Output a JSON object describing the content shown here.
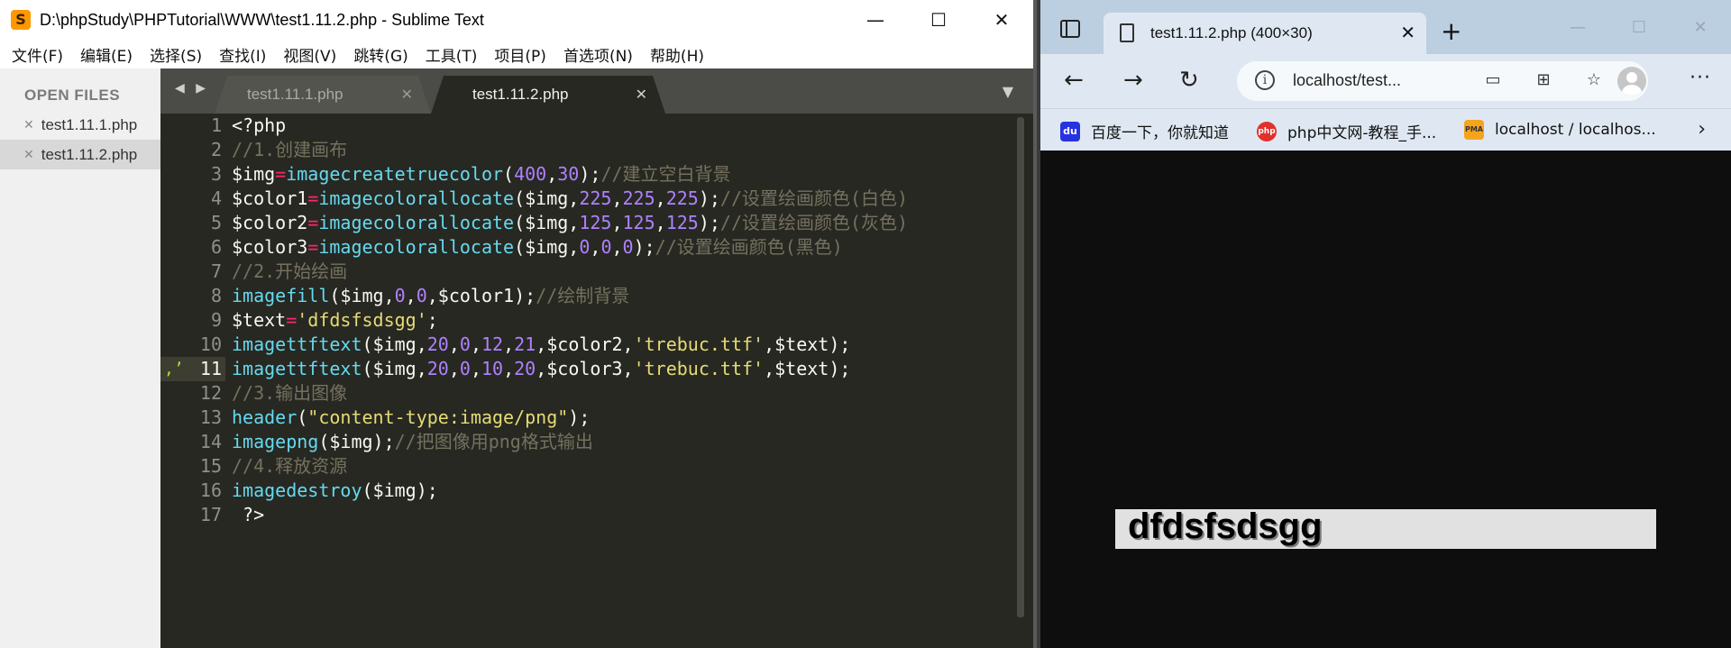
{
  "sublime": {
    "title": "D:\\phpStudy\\PHPTutorial\\WWW\\test1.11.2.php - Sublime Text",
    "logo": "S",
    "menu": [
      "文件(F)",
      "编辑(E)",
      "选择(S)",
      "查找(I)",
      "视图(V)",
      "跳转(G)",
      "工具(T)",
      "项目(P)",
      "首选项(N)",
      "帮助(H)"
    ],
    "sidebar": {
      "heading": "OPEN FILES",
      "files": [
        {
          "name": "test1.11.1.php",
          "active": false
        },
        {
          "name": "test1.11.2.php",
          "active": true
        }
      ]
    },
    "tabs": [
      {
        "label": "test1.11.1.php",
        "active": false
      },
      {
        "label": "test1.11.2.php",
        "active": true
      }
    ],
    "current_line": 11,
    "code_lines": [
      [
        {
          "t": "<?php",
          "c": "pl"
        }
      ],
      [
        {
          "t": "//1.创建画布",
          "c": "cmt"
        }
      ],
      [
        {
          "t": "$img",
          "c": "pl"
        },
        {
          "t": "=",
          "c": "op"
        },
        {
          "t": "imagecreatetruecolor",
          "c": "fn"
        },
        {
          "t": "(",
          "c": "pl"
        },
        {
          "t": "400",
          "c": "num"
        },
        {
          "t": ",",
          "c": "pl"
        },
        {
          "t": "30",
          "c": "num"
        },
        {
          "t": ");",
          "c": "pl"
        },
        {
          "t": "//建立空白背景",
          "c": "cmt"
        }
      ],
      [
        {
          "t": "$color1",
          "c": "pl"
        },
        {
          "t": "=",
          "c": "op"
        },
        {
          "t": "imagecolorallocate",
          "c": "fn"
        },
        {
          "t": "($img,",
          "c": "pl"
        },
        {
          "t": "225",
          "c": "num"
        },
        {
          "t": ",",
          "c": "pl"
        },
        {
          "t": "225",
          "c": "num"
        },
        {
          "t": ",",
          "c": "pl"
        },
        {
          "t": "225",
          "c": "num"
        },
        {
          "t": ");",
          "c": "pl"
        },
        {
          "t": "//设置绘画颜色(白色)",
          "c": "cmt"
        }
      ],
      [
        {
          "t": "$color2",
          "c": "pl"
        },
        {
          "t": "=",
          "c": "op"
        },
        {
          "t": "imagecolorallocate",
          "c": "fn"
        },
        {
          "t": "($img,",
          "c": "pl"
        },
        {
          "t": "125",
          "c": "num"
        },
        {
          "t": ",",
          "c": "pl"
        },
        {
          "t": "125",
          "c": "num"
        },
        {
          "t": ",",
          "c": "pl"
        },
        {
          "t": "125",
          "c": "num"
        },
        {
          "t": ");",
          "c": "pl"
        },
        {
          "t": "//设置绘画颜色(灰色)",
          "c": "cmt"
        }
      ],
      [
        {
          "t": "$color3",
          "c": "pl"
        },
        {
          "t": "=",
          "c": "op"
        },
        {
          "t": "imagecolorallocate",
          "c": "fn"
        },
        {
          "t": "($img,",
          "c": "pl"
        },
        {
          "t": "0",
          "c": "num"
        },
        {
          "t": ",",
          "c": "pl"
        },
        {
          "t": "0",
          "c": "num"
        },
        {
          "t": ",",
          "c": "pl"
        },
        {
          "t": "0",
          "c": "num"
        },
        {
          "t": ");",
          "c": "pl"
        },
        {
          "t": "//设置绘画颜色(黑色)",
          "c": "cmt"
        }
      ],
      [
        {
          "t": "//2.开始绘画",
          "c": "cmt"
        }
      ],
      [
        {
          "t": "imagefill",
          "c": "fn"
        },
        {
          "t": "($img,",
          "c": "pl"
        },
        {
          "t": "0",
          "c": "num"
        },
        {
          "t": ",",
          "c": "pl"
        },
        {
          "t": "0",
          "c": "num"
        },
        {
          "t": ",$color1);",
          "c": "pl"
        },
        {
          "t": "//绘制背景",
          "c": "cmt"
        }
      ],
      [
        {
          "t": "$text",
          "c": "pl"
        },
        {
          "t": "=",
          "c": "op"
        },
        {
          "t": "'dfdsfsdsgg'",
          "c": "str"
        },
        {
          "t": ";",
          "c": "pl"
        }
      ],
      [
        {
          "t": "imagettftext",
          "c": "fn"
        },
        {
          "t": "($img,",
          "c": "pl"
        },
        {
          "t": "20",
          "c": "num"
        },
        {
          "t": ",",
          "c": "pl"
        },
        {
          "t": "0",
          "c": "num"
        },
        {
          "t": ",",
          "c": "pl"
        },
        {
          "t": "12",
          "c": "num"
        },
        {
          "t": ",",
          "c": "pl"
        },
        {
          "t": "21",
          "c": "num"
        },
        {
          "t": ",$color2,",
          "c": "pl"
        },
        {
          "t": "'trebuc.ttf'",
          "c": "str"
        },
        {
          "t": ",$text);",
          "c": "pl"
        }
      ],
      [
        {
          "t": "imagettftext",
          "c": "fn"
        },
        {
          "t": "($img,",
          "c": "pl"
        },
        {
          "t": "20",
          "c": "num"
        },
        {
          "t": ",",
          "c": "pl"
        },
        {
          "t": "0",
          "c": "num"
        },
        {
          "t": ",",
          "c": "pl"
        },
        {
          "t": "10",
          "c": "num"
        },
        {
          "t": ",",
          "c": "pl"
        },
        {
          "t": "20",
          "c": "num"
        },
        {
          "t": ",$color3,",
          "c": "pl"
        },
        {
          "t": "'trebuc.ttf'",
          "c": "str"
        },
        {
          "t": ",$text);",
          "c": "pl"
        }
      ],
      [
        {
          "t": "//3.输出图像",
          "c": "cmt"
        }
      ],
      [
        {
          "t": "header",
          "c": "fn"
        },
        {
          "t": "(",
          "c": "pl"
        },
        {
          "t": "\"content-type:image/png\"",
          "c": "str"
        },
        {
          "t": ");",
          "c": "pl"
        }
      ],
      [
        {
          "t": "imagepng",
          "c": "fn"
        },
        {
          "t": "($img);",
          "c": "pl"
        },
        {
          "t": "//把图像用png格式输出",
          "c": "cmt"
        }
      ],
      [
        {
          "t": "//4.释放资源",
          "c": "cmt"
        }
      ],
      [
        {
          "t": "imagedestroy",
          "c": "fn"
        },
        {
          "t": "($img);",
          "c": "pl"
        }
      ],
      [
        {
          "t": " ?>",
          "c": "pl"
        }
      ]
    ]
  },
  "edge": {
    "tab_title": "test1.11.2.php (400×30)",
    "new_tab": "+",
    "url": "localhost/test...",
    "bookmarks": [
      {
        "label": "百度一下，你就知道",
        "icon": "baidu-icon",
        "color": "#2932e1",
        "glyph": "du"
      },
      {
        "label": "php中文网-教程_手...",
        "icon": "php-cn-icon",
        "color": "#e0312c",
        "glyph": "php"
      },
      {
        "label": "localhost / localhos...",
        "icon": "phpmyadmin-icon",
        "color": "#f4a41d",
        "glyph": "PMA"
      }
    ],
    "rendered_image": {
      "text": "dfdsfsdsgg",
      "background": "#e1e1e1",
      "shadow_color": "#7d7d7d",
      "text_color": "#000000"
    }
  },
  "colors": {
    "editor_bg": "#272822",
    "comment": "#75715e",
    "function": "#66d9ef",
    "operator": "#f92672",
    "number": "#ae81ff",
    "string": "#e6db74",
    "plain": "#f8f8f2"
  }
}
